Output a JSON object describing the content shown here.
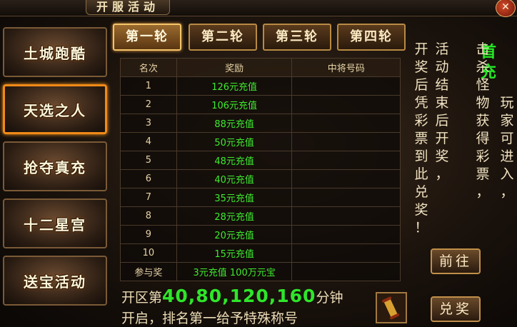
{
  "window": {
    "title": "开服活动",
    "close_label": "✕"
  },
  "sidebar": {
    "items": [
      {
        "label": "土城跑酷"
      },
      {
        "label": "天选之人",
        "active": true
      },
      {
        "label": "抢夺真充"
      },
      {
        "label": "十二星宫"
      },
      {
        "label": "送宝活动"
      }
    ]
  },
  "tabs": [
    {
      "label": "第一轮",
      "active": true
    },
    {
      "label": "第二轮"
    },
    {
      "label": "第三轮"
    },
    {
      "label": "第四轮"
    }
  ],
  "table": {
    "headers": [
      "名次",
      "奖励",
      "中将号码"
    ],
    "rows": [
      {
        "rank": "1",
        "reward": "126元充值",
        "number": ""
      },
      {
        "rank": "2",
        "reward": "106元充值",
        "number": ""
      },
      {
        "rank": "3",
        "reward": "88元充值",
        "number": ""
      },
      {
        "rank": "4",
        "reward": "50元充值",
        "number": ""
      },
      {
        "rank": "5",
        "reward": "48元充值",
        "number": ""
      },
      {
        "rank": "6",
        "reward": "40元充值",
        "number": ""
      },
      {
        "rank": "7",
        "reward": "35元充值",
        "number": ""
      },
      {
        "rank": "8",
        "reward": "28元充值",
        "number": ""
      },
      {
        "rank": "9",
        "reward": "20元充值",
        "number": ""
      },
      {
        "rank": "10",
        "reward": "15元充值",
        "number": ""
      },
      {
        "rank": "参与奖",
        "reward": "3元充值 100万元宝",
        "number": ""
      }
    ]
  },
  "info": {
    "first_charge": "首充",
    "col1": "玩家可进入，",
    "col2": "击杀怪物获得彩票，",
    "col3": "活动结束后开奖，",
    "col4": "开奖后凭彩票到此兑奖！"
  },
  "buttons": {
    "goto": "前往",
    "redeem": "兑奖"
  },
  "footer": {
    "line1_prefix": "开区第",
    "times": "40,80,120,160",
    "line1_suffix": "分钟",
    "line2": "开启，排名第一给予特殊称号"
  },
  "colors": {
    "accent": "#f08a18",
    "reward_green": "#3eea2e"
  },
  "icons": {
    "close": "close-icon",
    "scroll": "scroll-icon"
  }
}
